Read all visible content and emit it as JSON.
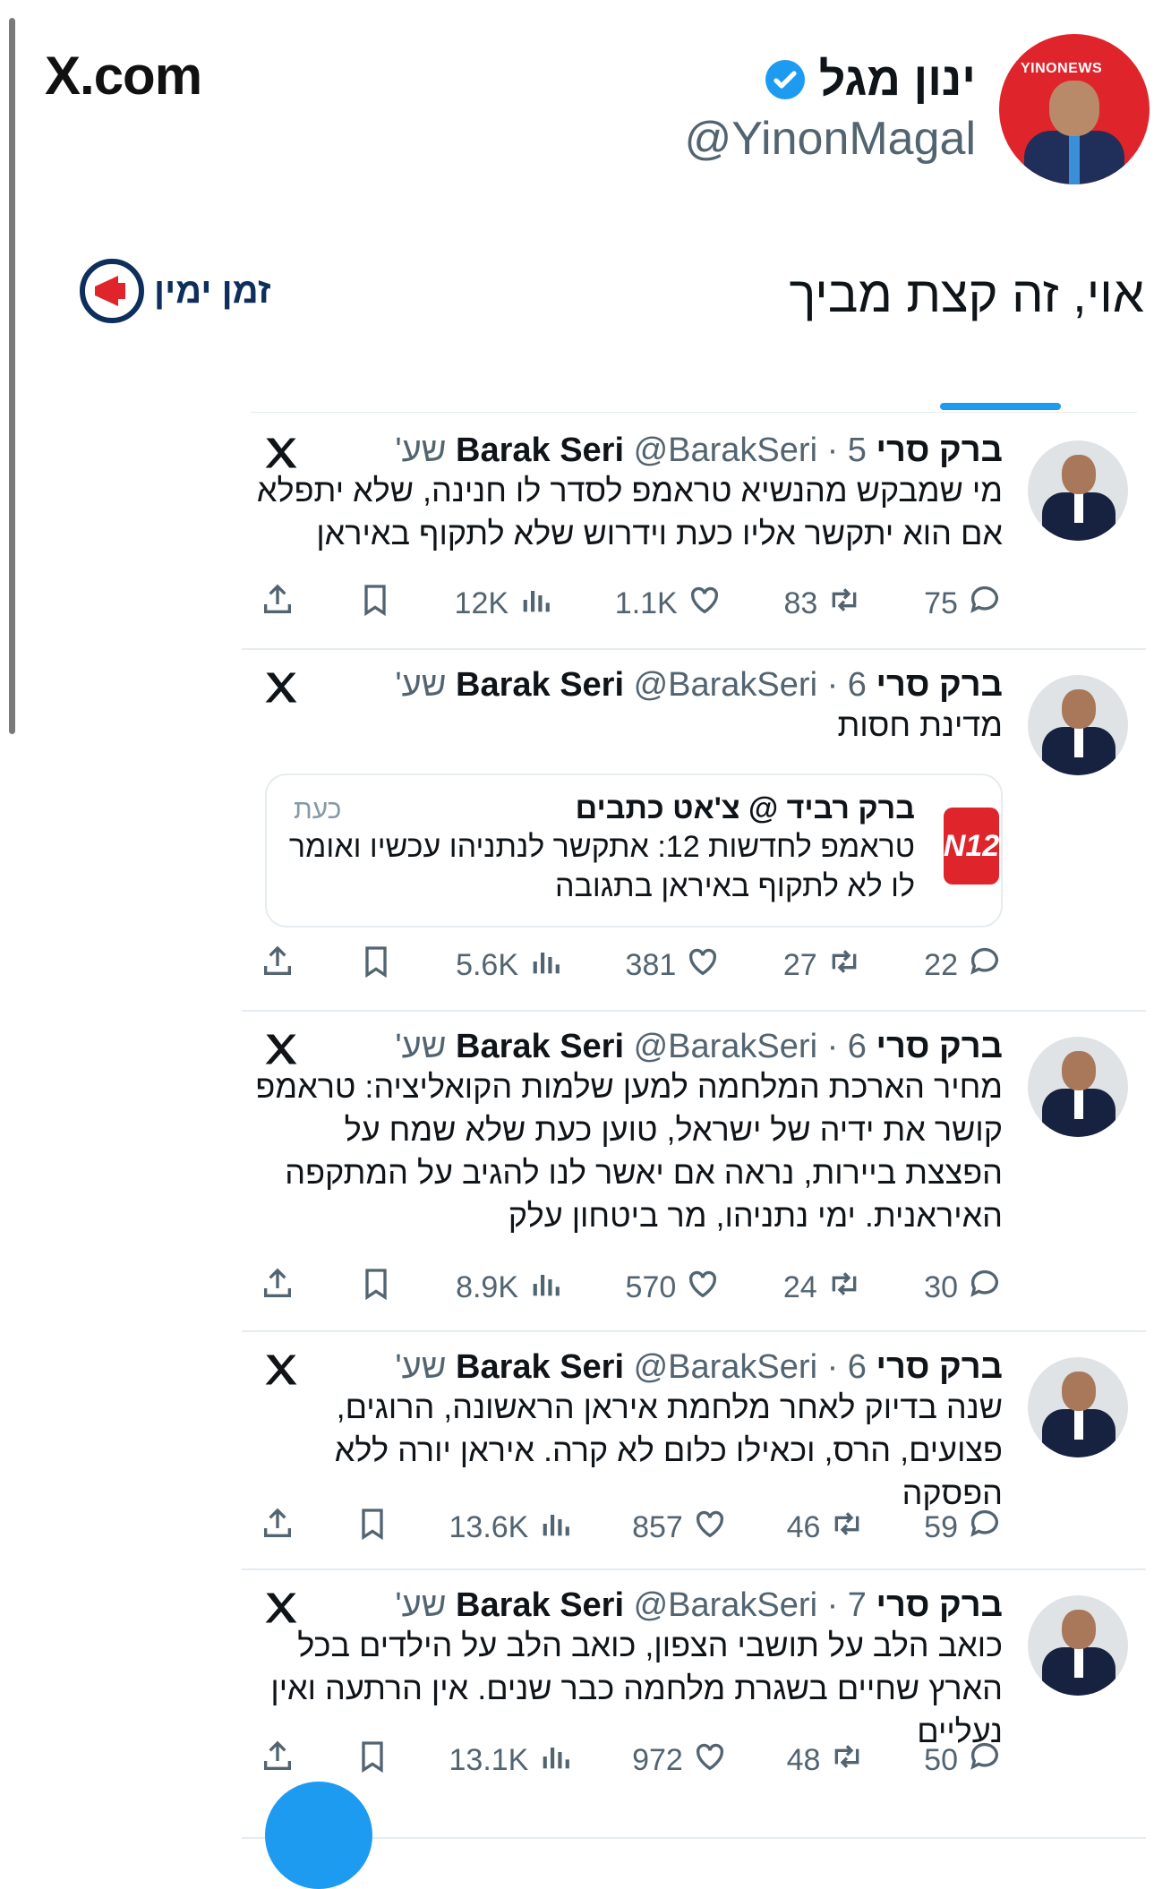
{
  "site": "X.com",
  "author": {
    "name": "ינון מגל",
    "handle": "@YinonMagal",
    "avatar_text": "YINONEWS"
  },
  "post_text": "אוי, זה קצת מביך",
  "watermark": "זמן ימין",
  "tweets": [
    {
      "name": "ברק סרי Barak Seri",
      "meta": "@BarakSeri · 5 שע'",
      "text": "מי שמבקש מהנשיא טראמפ לסדר לו חנינה, שלא יתפלא אם הוא יתקשר אליו כעת וידרוש שלא לתקוף באיראן",
      "replies": "75",
      "reposts": "83",
      "likes": "1.1K",
      "views": "12K"
    },
    {
      "name": "ברק סרי Barak Seri",
      "meta": "@BarakSeri · 6 שע'",
      "text": "מדינת חסות",
      "quote": {
        "name": "ברק רביד @ צ'אט כתבים",
        "time": "כעת",
        "text": "טראמפ לחדשות 12: אתקשר לנתניהו עכשיו ואומר לו לא לתקוף באיראן בתגובה",
        "logo": "N12"
      },
      "replies": "22",
      "reposts": "27",
      "likes": "381",
      "views": "5.6K"
    },
    {
      "name": "ברק סרי Barak Seri",
      "meta": "@BarakSeri · 6 שע'",
      "text": "מחיר הארכת המלחמה למען שלמות הקואליציה: טראמפ קושר את ידיה של ישראל, טוען כעת שלא שמח על הפצצת ביירות, נראה אם יאשר לנו להגיב על המתקפה האיראנית. ימי נתניהו, מר ביטחון עלק",
      "replies": "30",
      "reposts": "24",
      "likes": "570",
      "views": "8.9K"
    },
    {
      "name": "ברק סרי Barak Seri",
      "meta": "@BarakSeri · 6 שע'",
      "text": "שנה בדיוק לאחר מלחמת איראן הראשונה, הרוגים, פצועים, הרס, וכאילו כלום לא קרה. איראן יורה ללא הפסקה",
      "replies": "59",
      "reposts": "46",
      "likes": "857",
      "views": "13.6K"
    },
    {
      "name": "ברק סרי Barak Seri",
      "meta": "@BarakSeri · 7 שע'",
      "text": "כואב הלב על תושבי הצפון, כואב הלב על הילדים בכל הארץ שחיים בשגרת מלחמה כבר שנים. אין הרתעה ואין נעליים",
      "replies": "50",
      "reposts": "48",
      "likes": "972",
      "views": "13.1K"
    }
  ]
}
